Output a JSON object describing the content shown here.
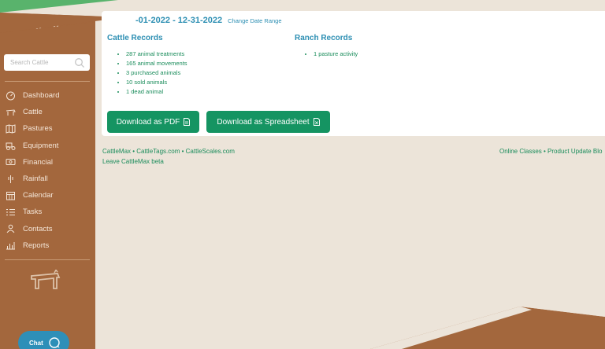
{
  "header": {
    "date_range": "-01-2022 - 12-31-2022",
    "change_date_range": "Change Date Range"
  },
  "sidebar": {
    "search_placeholder": "Search Cattle",
    "items": [
      {
        "label": "Dashboard",
        "icon": "dashboard-icon"
      },
      {
        "label": "Cattle",
        "icon": "cattle-icon"
      },
      {
        "label": "Pastures",
        "icon": "pastures-icon"
      },
      {
        "label": "Equipment",
        "icon": "equipment-icon"
      },
      {
        "label": "Financial",
        "icon": "financial-icon"
      },
      {
        "label": "Rainfall",
        "icon": "rainfall-icon"
      },
      {
        "label": "Calendar",
        "icon": "calendar-icon"
      },
      {
        "label": "Tasks",
        "icon": "tasks-icon"
      },
      {
        "label": "Contacts",
        "icon": "contacts-icon"
      },
      {
        "label": "Reports",
        "icon": "reports-icon"
      }
    ],
    "chat_label": "Chat"
  },
  "cattle_records": {
    "title": "Cattle Records",
    "items": [
      "287 animal treatments",
      "165 animal movements",
      "3 purchased animals",
      "10 sold animals",
      "1 dead animal"
    ]
  },
  "ranch_records": {
    "title": "Ranch Records",
    "items": [
      "1 pasture activity"
    ]
  },
  "buttons": {
    "pdf": "Download as PDF",
    "spreadsheet": "Download as Spreadsheet"
  },
  "footer": {
    "links_left": "CattleMax • CattleTags.com • CattleScales.com",
    "leave_beta": "Leave CattleMax beta",
    "links_right": "Online Classes • Product Update Blo"
  },
  "colors": {
    "sidebar_bg": "#a3673d",
    "page_bg": "#ece4d9",
    "accent_blue": "#2d8fb3",
    "accent_green": "#159462",
    "chat_bg": "#2e8fb8"
  }
}
